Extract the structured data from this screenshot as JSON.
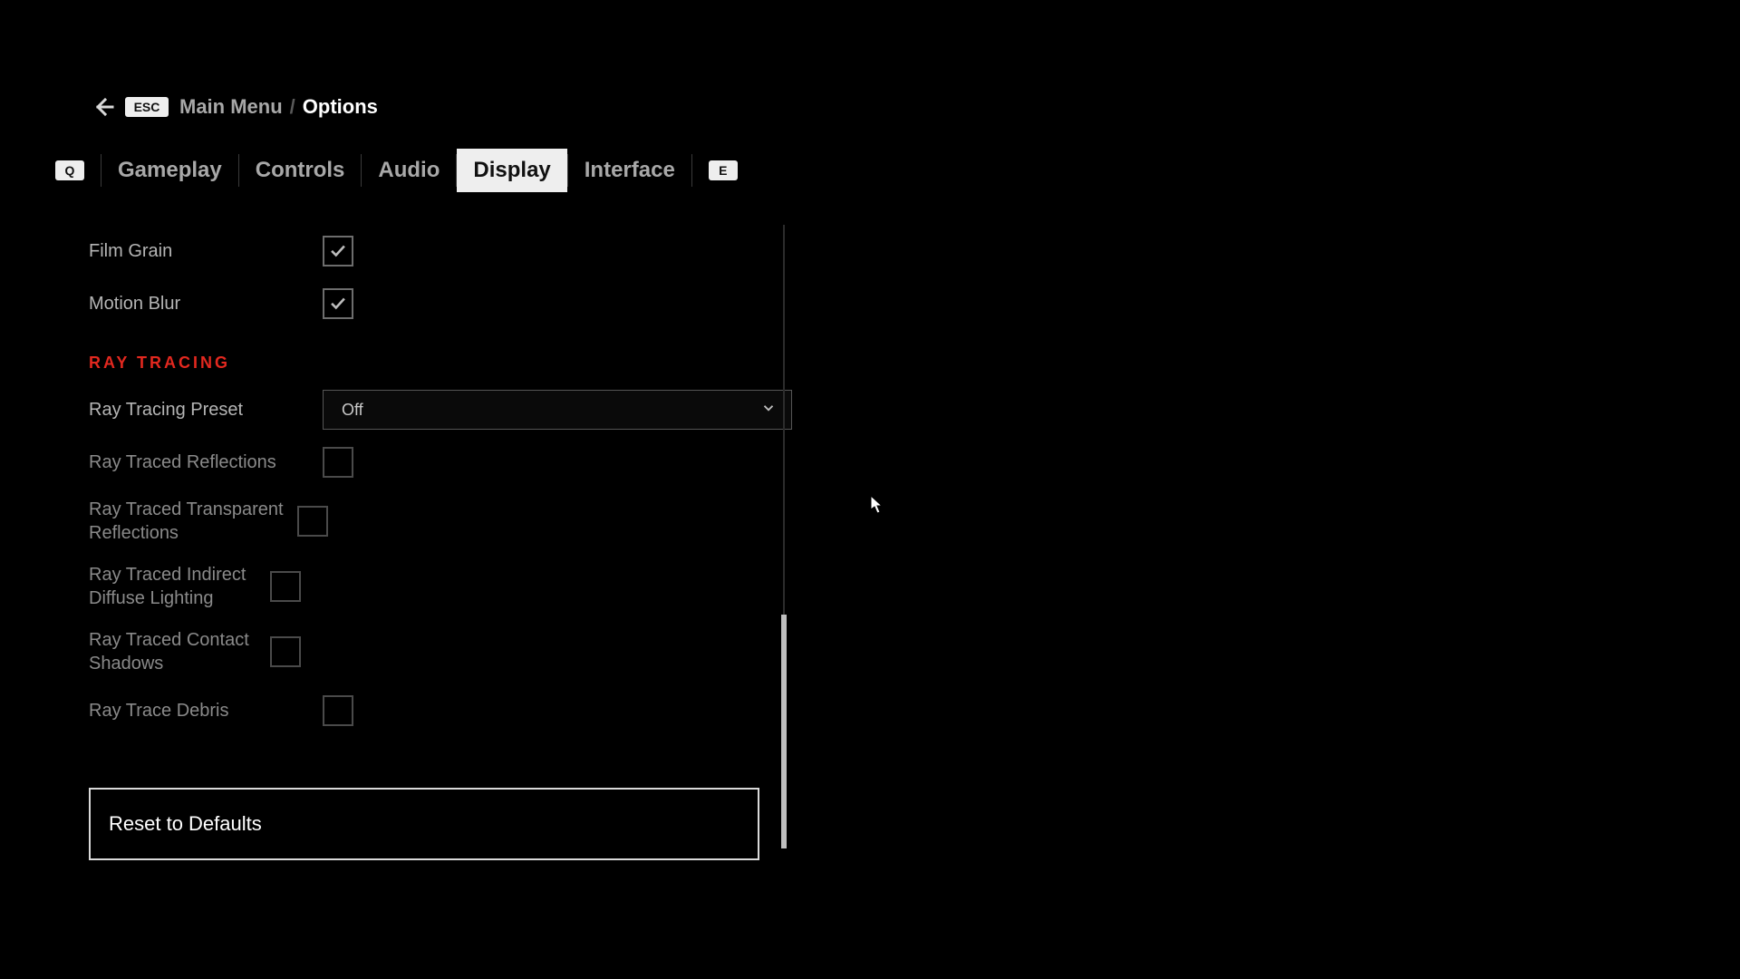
{
  "breadcrumb": {
    "esc_key": "ESC",
    "main_menu": "Main Menu",
    "separator": "/",
    "current": "Options"
  },
  "tab_keys": {
    "left": "Q",
    "right": "E"
  },
  "tabs": [
    {
      "id": "gameplay",
      "label": "Gameplay",
      "active": false
    },
    {
      "id": "controls",
      "label": "Controls",
      "active": false
    },
    {
      "id": "audio",
      "label": "Audio",
      "active": false
    },
    {
      "id": "display",
      "label": "Display",
      "active": true
    },
    {
      "id": "interface",
      "label": "Interface",
      "active": false
    }
  ],
  "settings": {
    "film_grain": {
      "label": "Film Grain",
      "checked": true
    },
    "motion_blur": {
      "label": "Motion Blur",
      "checked": true
    }
  },
  "ray_tracing": {
    "section_title": "RAY TRACING",
    "preset": {
      "label": "Ray Tracing Preset",
      "value": "Off"
    },
    "options": [
      {
        "id": "rt_reflections",
        "label": "Ray Traced Reflections",
        "checked": false,
        "enabled": false
      },
      {
        "id": "rt_transparent",
        "label": "Ray Traced Transparent Reflections",
        "checked": false,
        "enabled": false
      },
      {
        "id": "rt_indirect",
        "label": "Ray Traced Indirect Diffuse Lighting",
        "checked": false,
        "enabled": false
      },
      {
        "id": "rt_contact",
        "label": "Ray Traced Contact Shadows",
        "checked": false,
        "enabled": false
      },
      {
        "id": "rt_debris",
        "label": "Ray Trace Debris",
        "checked": false,
        "enabled": false
      }
    ]
  },
  "reset_label": "Reset to Defaults"
}
